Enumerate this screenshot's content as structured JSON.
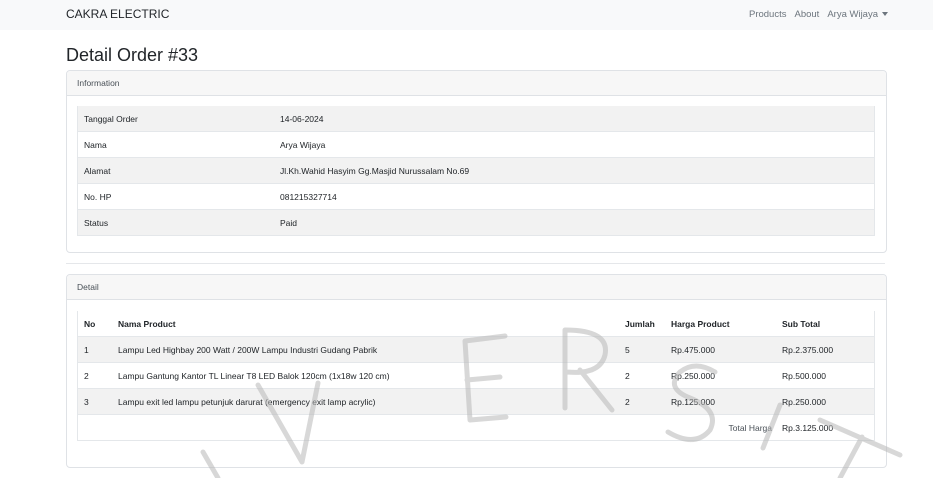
{
  "navbar": {
    "brand": "CAKRA ELECTRIC",
    "links": [
      "Products",
      "About"
    ],
    "user": "Arya Wijaya"
  },
  "page": {
    "title": "Detail Order #33"
  },
  "information": {
    "header": "Information",
    "rows": [
      {
        "label": "Tanggal Order",
        "value": "14-06-2024"
      },
      {
        "label": "Nama",
        "value": "Arya Wijaya"
      },
      {
        "label": "Alamat",
        "value": "Jl.Kh.Wahid Hasyim Gg.Masjid Nurussalam No.69"
      },
      {
        "label": "No. HP",
        "value": "081215327714"
      },
      {
        "label": "Status",
        "value": "Paid"
      }
    ]
  },
  "detail": {
    "header": "Detail",
    "columns": [
      "No",
      "Nama Product",
      "Jumlah",
      "Harga Product",
      "Sub Total"
    ],
    "rows": [
      {
        "no": "1",
        "name": "Lampu Led Highbay 200 Watt / 200W Lampu Industri Gudang Pabrik",
        "qty": "5",
        "price": "Rp.475.000",
        "subtotal": "Rp.2.375.000"
      },
      {
        "no": "2",
        "name": "Lampu Gantung Kantor TL Linear T8 LED Balok 120cm (1x18w 120 cm)",
        "qty": "2",
        "price": "Rp.250.000",
        "subtotal": "Rp.500.000"
      },
      {
        "no": "3",
        "name": "Lampu exit led lampu petunjuk darurat (emergency exit lamp acrylic)",
        "qty": "2",
        "price": "Rp.125.000",
        "subtotal": "Rp.250.000"
      }
    ],
    "total_label": "Total Harga",
    "total_value": "Rp.3.125.000"
  },
  "watermark": {
    "letters": [
      "I",
      "V",
      "E",
      "R",
      "S",
      "I",
      "T"
    ],
    "color": "#b8b8b8"
  }
}
